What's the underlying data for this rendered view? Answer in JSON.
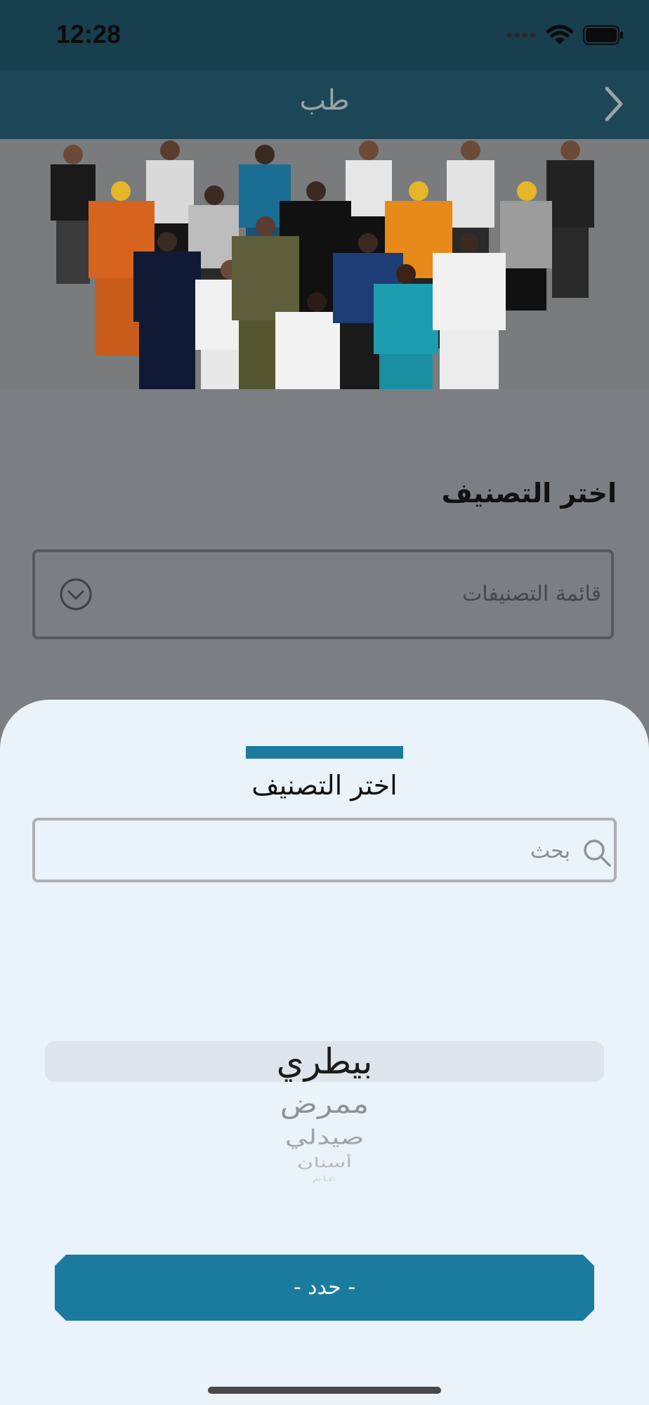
{
  "status_bar": {
    "time": "12:28"
  },
  "nav": {
    "title": "طب"
  },
  "page": {
    "section_title": "اختر التصنيف",
    "dropdown_placeholder": "قائمة التصنيفات"
  },
  "sheet": {
    "title": "اختر التصنيف",
    "search_placeholder": "بحث",
    "picker_items": [
      "بيطري",
      "ممرض",
      "صيدلي",
      "أسنان",
      "عام"
    ],
    "selected_index": 0,
    "select_button_label": "- حدد -"
  },
  "colors": {
    "accent": "#1b7b9f",
    "header_bg": "#1d4757",
    "sheet_bg": "#eaf3f9",
    "overlay_bg": "#7b7e82"
  },
  "icons": [
    "signal-icon",
    "wifi-icon",
    "battery-icon",
    "back-chevron-icon",
    "dropdown-chevron-icon",
    "search-icon"
  ]
}
